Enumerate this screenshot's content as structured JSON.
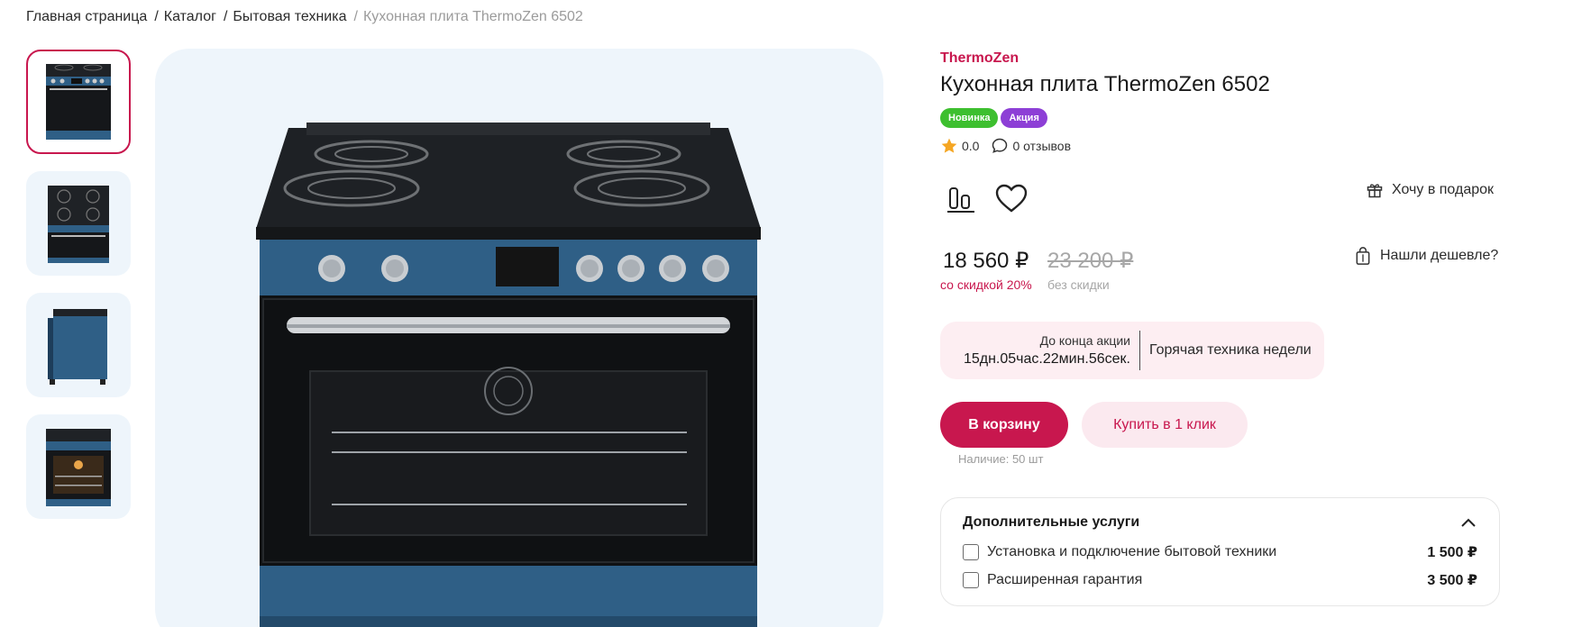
{
  "breadcrumb": {
    "items": [
      "Главная страница",
      "Каталог",
      "Бытовая техника",
      "Кухонная плита ThermoZen 6502"
    ],
    "separator": "/"
  },
  "gallery": {
    "thumbnails": [
      "stove-front-view",
      "stove-top-view",
      "stove-side-view",
      "stove-open-oven-view"
    ],
    "active_index": 0,
    "main_image": "stove-front-view"
  },
  "product": {
    "brand": "ThermoZen",
    "title": "Кухонная плита ThermoZen 6502",
    "badges": {
      "new": "Новинка",
      "sale": "Акция"
    },
    "rating": "0.0",
    "reviews": "0 отзывов"
  },
  "actions": {
    "compare_icon": "compare-icon",
    "favorite_icon": "heart-icon",
    "gift_label": "Хочу в подарок",
    "cheaper_label": "Нашли дешевле?"
  },
  "price": {
    "current": "18 560 ₽",
    "current_note": "со скидкой 20%",
    "old": "23 200 ₽",
    "old_note": "без скидки"
  },
  "promo": {
    "label": "До конца акции",
    "timer": "15дн.05час.22мин.56сек.",
    "name": "Горячая техника недели"
  },
  "buttons": {
    "cart": "В корзину",
    "one_click": "Купить в 1 клик"
  },
  "stock": "Наличие: 50 шт",
  "services": {
    "title": "Дополнительные услуги",
    "items": [
      {
        "label": "Установка и подключение бытовой техники",
        "price": "1 500 ₽"
      },
      {
        "label": "Расширенная гарантия",
        "price": "3 500 ₽"
      }
    ]
  },
  "colors": {
    "accent": "#c8174e",
    "badge_new": "#3dbf2f",
    "badge_sale": "#8d3fd6",
    "image_bg": "#eef5fb",
    "stove_blue": "#2f5f86"
  }
}
